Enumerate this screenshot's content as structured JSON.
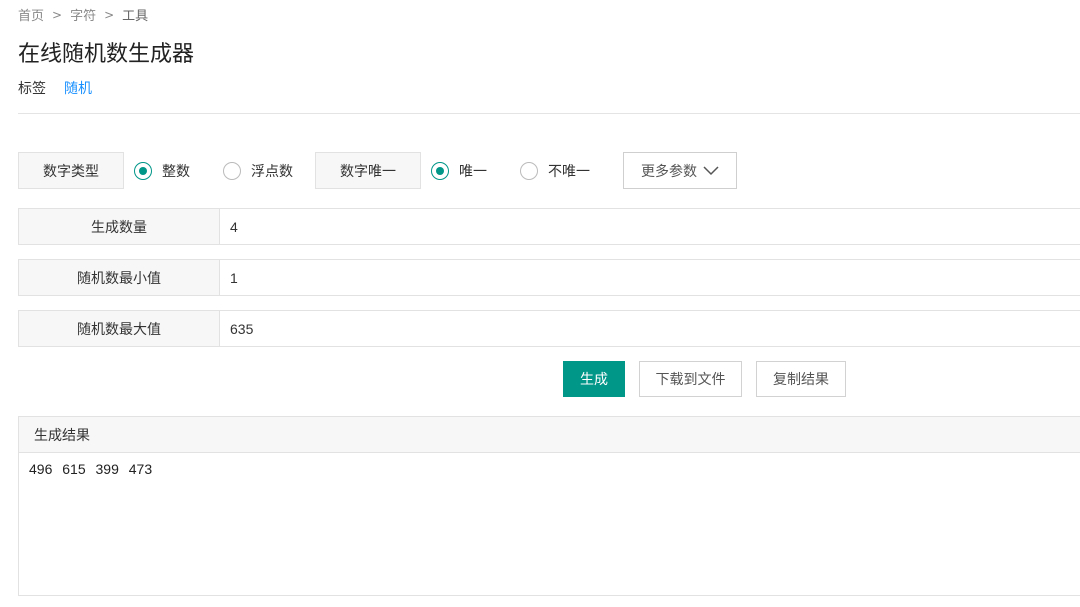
{
  "breadcrumb": {
    "items": [
      "首页",
      "字符",
      "工具"
    ],
    "separator": ">"
  },
  "page_title": "在线随机数生成器",
  "tags": {
    "label": "标签",
    "items": [
      "随机"
    ]
  },
  "options": {
    "number_type_label": "数字类型",
    "number_type_options": [
      "整数",
      "浮点数"
    ],
    "number_type_selected": "整数",
    "unique_label": "数字唯一",
    "unique_options": [
      "唯一",
      "不唯一"
    ],
    "unique_selected": "唯一",
    "more_params_label": "更多参数",
    "more_params_icon": "chevron-down-icon"
  },
  "fields": {
    "count_label": "生成数量",
    "count_value": "4",
    "min_label": "随机数最小值",
    "min_value": "1",
    "max_label": "随机数最大值",
    "max_value": "635"
  },
  "actions": {
    "generate": "生成",
    "download": "下载到文件",
    "copy": "复制结果"
  },
  "result": {
    "title": "生成结果",
    "value": "496 615 399 473"
  },
  "colors": {
    "accent": "#009688",
    "link": "#1890ff"
  }
}
